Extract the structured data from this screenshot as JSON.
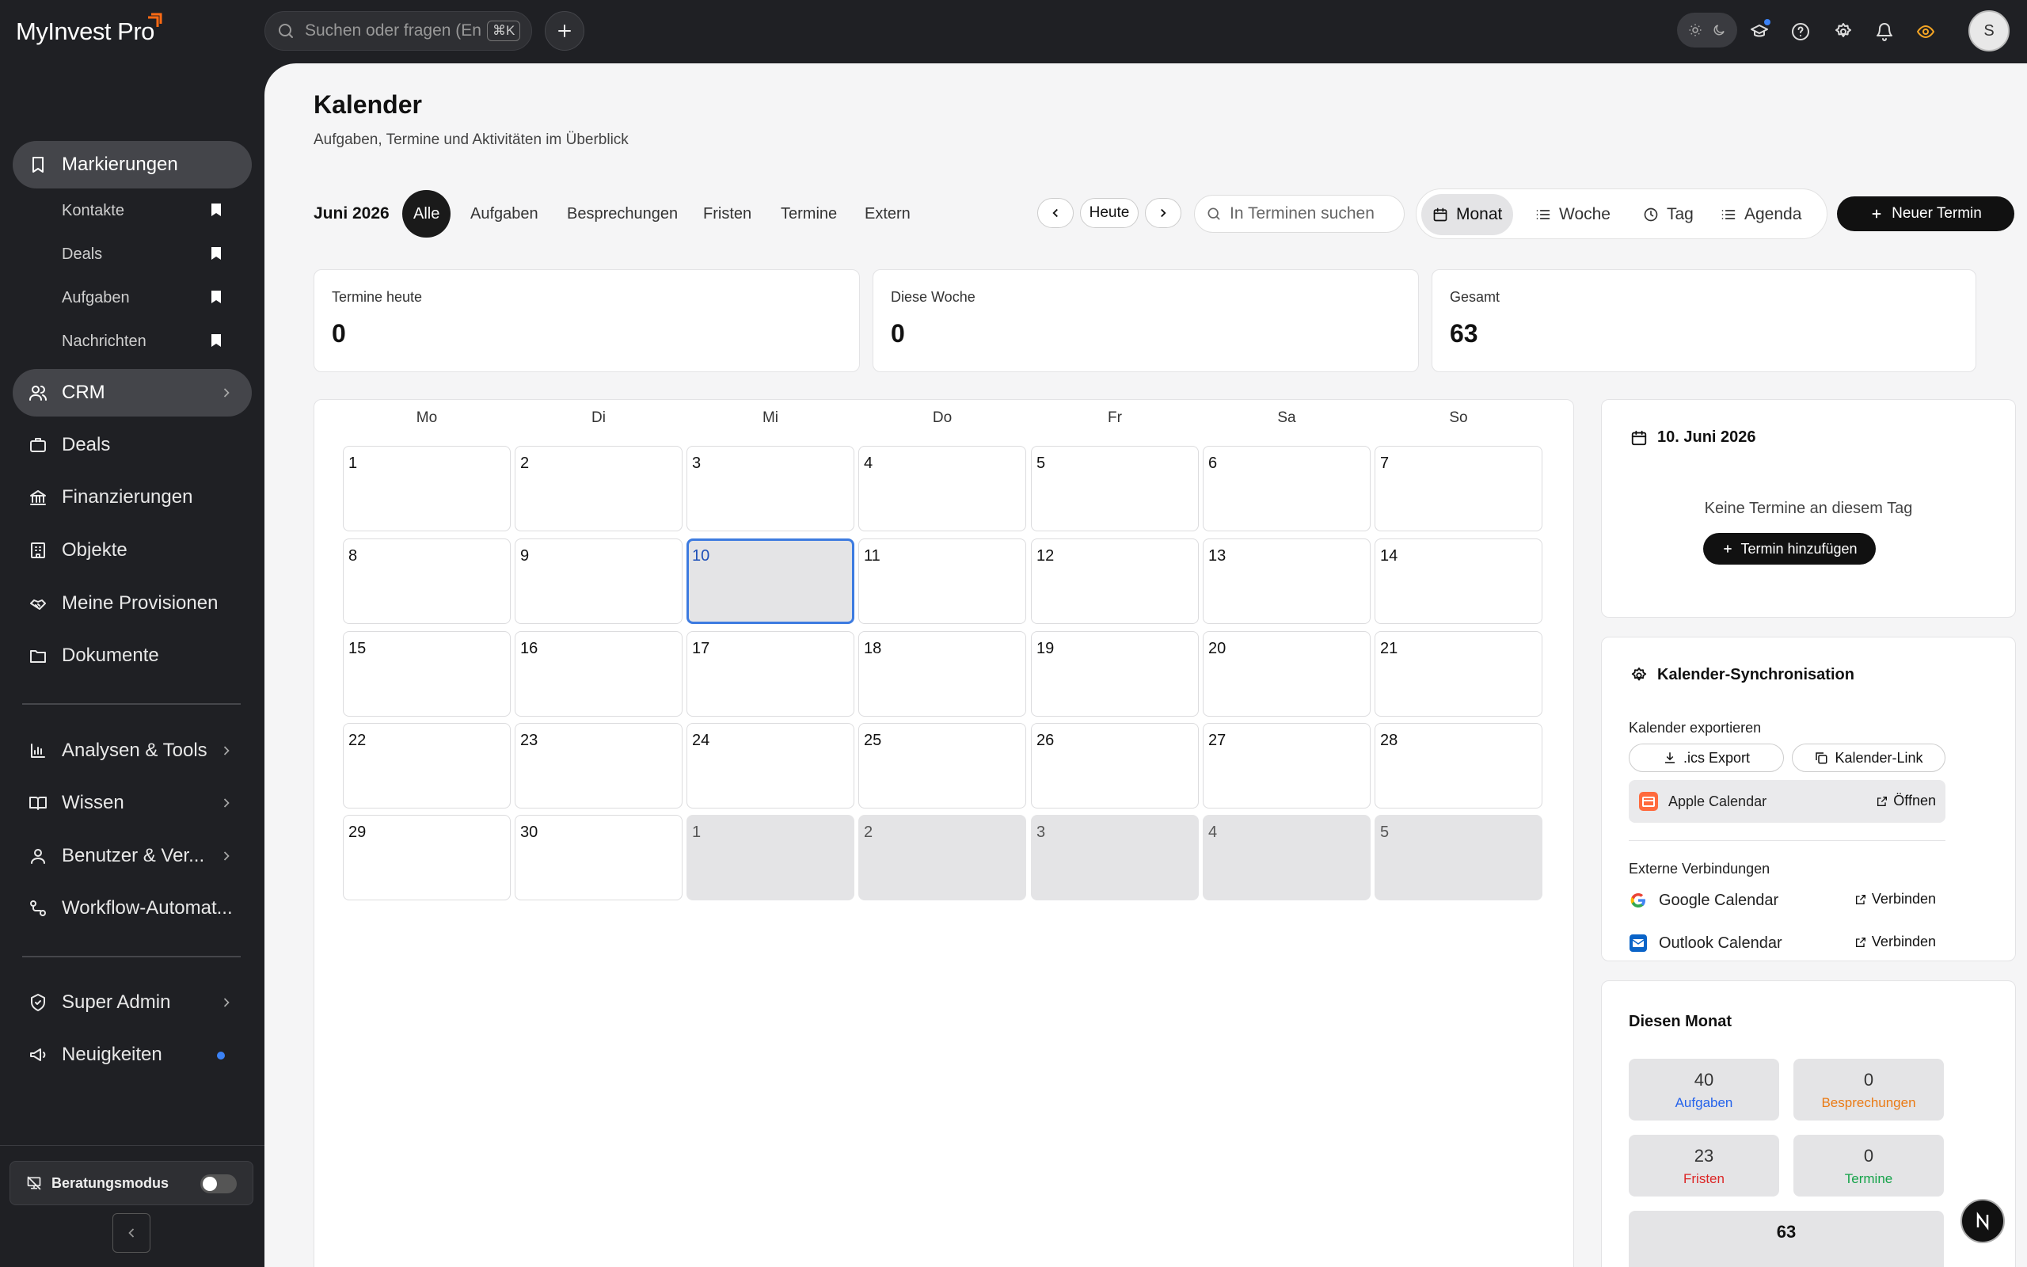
{
  "app": {
    "name": "MyInvest Pro"
  },
  "topbar": {
    "search_placeholder": "Suchen oder fragen (Ent",
    "shortcut": "⌘K",
    "avatar_initial": "S"
  },
  "sidebar": {
    "bookmarks": {
      "label": "Markierungen",
      "items": [
        "Kontakte",
        "Deals",
        "Aufgaben",
        "Nachrichten"
      ]
    },
    "items": [
      "CRM",
      "Deals",
      "Finanzierungen",
      "Objekte",
      "Meine Provisionen",
      "Dokumente"
    ],
    "groups": [
      "Analysen & Tools",
      "Wissen",
      "Benutzer & Ver...",
      "Workflow-Automat..."
    ],
    "admin": [
      "Super Admin",
      "Neuigkeiten"
    ],
    "consult_mode": "Beratungsmodus"
  },
  "page": {
    "title": "Kalender",
    "subtitle": "Aufgaben, Termine und Aktivitäten im Überblick"
  },
  "toolbar": {
    "month": "Juni 2026",
    "filters": [
      "Alle",
      "Aufgaben",
      "Besprechungen",
      "Fristen",
      "Termine",
      "Extern"
    ],
    "today": "Heute",
    "search_placeholder": "In Terminen suchen",
    "views": [
      "Monat",
      "Woche",
      "Tag",
      "Agenda"
    ],
    "new_event": "Neuer Termin"
  },
  "stats": [
    {
      "label": "Termine heute",
      "value": "0"
    },
    {
      "label": "Diese Woche",
      "value": "0"
    },
    {
      "label": "Gesamt",
      "value": "63"
    }
  ],
  "calendar": {
    "weekdays": [
      "Mo",
      "Di",
      "Mi",
      "Do",
      "Fr",
      "Sa",
      "So"
    ],
    "days": [
      "1",
      "2",
      "3",
      "4",
      "5",
      "6",
      "7",
      "8",
      "9",
      "10",
      "11",
      "12",
      "13",
      "14",
      "15",
      "16",
      "17",
      "18",
      "19",
      "20",
      "21",
      "22",
      "23",
      "24",
      "25",
      "26",
      "27",
      "28",
      "29",
      "30",
      "1",
      "2",
      "3",
      "4",
      "5"
    ],
    "selected_index": 9,
    "other_month_from_index": 30
  },
  "day_panel": {
    "date": "10. Juni 2026",
    "empty": "Keine Termine an diesem Tag",
    "add": "Termin hinzufügen"
  },
  "sync_panel": {
    "title": "Kalender-Synchronisation",
    "export_label": "Kalender exportieren",
    "ics": ".ics Export",
    "link": "Kalender-Link",
    "apple": "Apple Calendar",
    "open": "Öffnen",
    "external_label": "Externe Verbindungen",
    "google": "Google Calendar",
    "outlook": "Outlook Calendar",
    "connect": "Verbinden"
  },
  "month_panel": {
    "title": "Diesen Monat",
    "stats": [
      {
        "value": "40",
        "label": "Aufgaben",
        "color": "#2563eb"
      },
      {
        "value": "0",
        "label": "Besprechungen",
        "color": "#ea7a14"
      },
      {
        "value": "23",
        "label": "Fristen",
        "color": "#dc2626"
      },
      {
        "value": "0",
        "label": "Termine",
        "color": "#16a34a"
      }
    ],
    "total": "63"
  },
  "colors": {
    "accent": "#3d7be0",
    "brand": "#ff6a13",
    "notification_dot": "#3b82f6"
  }
}
